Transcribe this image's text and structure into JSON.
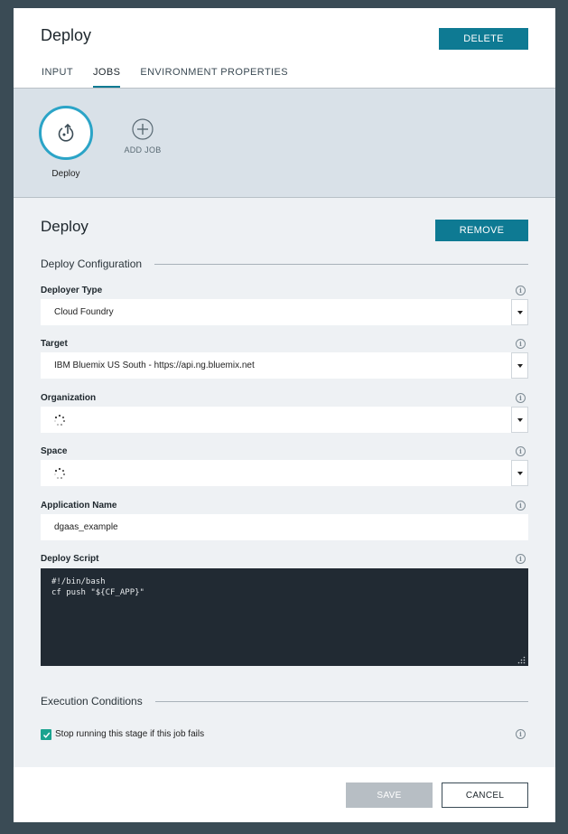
{
  "header": {
    "title": "Deploy",
    "delete_label": "DELETE",
    "tabs": [
      {
        "label": "INPUT",
        "active": false
      },
      {
        "label": "JOBS",
        "active": true
      },
      {
        "label": "ENVIRONMENT PROPERTIES",
        "active": false
      }
    ]
  },
  "jobs_strip": {
    "job": {
      "label": "Deploy",
      "icon": "deploy-job-icon"
    },
    "add_job_label": "ADD JOB"
  },
  "job_config": {
    "title": "Deploy",
    "remove_label": "REMOVE",
    "deploy_configuration_heading": "Deploy Configuration",
    "deployer_type": {
      "label": "Deployer Type",
      "value": "Cloud Foundry"
    },
    "target": {
      "label": "Target",
      "value": "IBM Bluemix US South - https://api.ng.bluemix.net"
    },
    "organization": {
      "label": "Organization",
      "loading": true
    },
    "space": {
      "label": "Space",
      "loading": true
    },
    "application_name": {
      "label": "Application Name",
      "value": "dgaas_example"
    },
    "deploy_script": {
      "label": "Deploy Script",
      "value": "#!/bin/bash\ncf push \"${CF_APP}\""
    },
    "execution_conditions_heading": "Execution Conditions",
    "stop_on_fail": {
      "label": "Stop running this stage if this job fails",
      "checked": true
    }
  },
  "footer": {
    "save_label": "SAVE",
    "cancel_label": "CANCEL"
  },
  "colors": {
    "accent": "#0e7a93",
    "job_ring": "#2ba4c7",
    "checkbox": "#1aa38f",
    "script_bg": "#212a33",
    "backdrop": "#3a4b55"
  }
}
